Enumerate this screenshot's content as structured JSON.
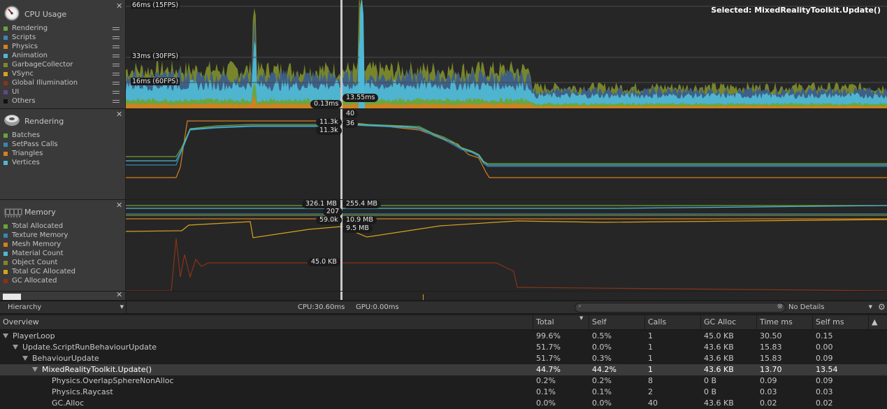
{
  "colors": {
    "rendering": "#6aa53a",
    "scripts": "#3a86b4",
    "physics": "#d4801e",
    "animation": "#4fb8d4",
    "garbage": "#7c8a2a",
    "vsync": "#d9a21e",
    "gi": "#8a3318",
    "ui": "#5d4a8c",
    "others": "#000000",
    "grid": "#4a4a4a",
    "cursor": "#c8c8c8"
  },
  "cpu": {
    "title": "CPU Usage",
    "icon": "cpu-meter-icon",
    "legend": [
      {
        "label": "Rendering",
        "color": "#6aa53a"
      },
      {
        "label": "Scripts",
        "color": "#3a86b4"
      },
      {
        "label": "Physics",
        "color": "#d4801e"
      },
      {
        "label": "Animation",
        "color": "#4fb8d4"
      },
      {
        "label": "GarbageCollector",
        "color": "#7c8a2a"
      },
      {
        "label": "VSync",
        "color": "#d9a21e"
      },
      {
        "label": "Global Illumination",
        "color": "#8a3318"
      },
      {
        "label": "UI",
        "color": "#5d4a8c"
      },
      {
        "label": "Others",
        "color": "#111111"
      }
    ],
    "ref_66": "66ms (15FPS)",
    "ref_33": "33ms (30FPS)",
    "ref_16": "16ms (60FPS)",
    "selected_label": "Selected: MixedRealityToolkit.Update()",
    "tag_left": "0.13ms",
    "tag_right": "13.55ms"
  },
  "rendering": {
    "title": "Rendering",
    "icon": "rendering-sphere-icon",
    "legend": [
      {
        "label": "Batches",
        "color": "#6aa53a"
      },
      {
        "label": "SetPass Calls",
        "color": "#3a86b4"
      },
      {
        "label": "Triangles",
        "color": "#d4801e"
      },
      {
        "label": "Vertices",
        "color": "#4fb8d4"
      }
    ],
    "tag_a": "40",
    "tag_b": "11.3k",
    "tag_c": "36",
    "tag_d": "11.3k"
  },
  "memory": {
    "title": "Memory",
    "icon": "memory-chip-icon",
    "legend": [
      {
        "label": "Total Allocated",
        "color": "#6aa53a"
      },
      {
        "label": "Texture Memory",
        "color": "#3a86b4"
      },
      {
        "label": "Mesh Memory",
        "color": "#d4801e"
      },
      {
        "label": "Material Count",
        "color": "#4fb8d4"
      },
      {
        "label": "Object Count",
        "color": "#7c8a2a"
      },
      {
        "label": "Total GC Allocated",
        "color": "#d9a21e"
      },
      {
        "label": "GC Allocated",
        "color": "#8a3318"
      }
    ],
    "tag_total": "326.1 MB",
    "tag_texture": "255.4 MB",
    "tag_materials": "207",
    "tag_objects": "59.0k",
    "tag_mesh": "10.9 MB",
    "tag_gc_total": "9.5 MB",
    "tag_gc": "45.0 KB"
  },
  "toolbar": {
    "view_mode": "Hierarchy",
    "cpu_time": "CPU:30.60ms",
    "gpu_time": "GPU:0.00ms",
    "search_placeholder": "",
    "details_mode": "No Details"
  },
  "table": {
    "columns": [
      "Overview",
      "Total",
      "Self",
      "Calls",
      "GC Alloc",
      "Time ms",
      "Self ms"
    ],
    "rows": [
      {
        "name": "PlayerLoop",
        "indent": 0,
        "expanded": true,
        "total": "99.6%",
        "self": "0.5%",
        "calls": "1",
        "gc": "45.0 KB",
        "time": "30.50",
        "selfms": "0.15",
        "selected": false
      },
      {
        "name": "Update.ScriptRunBehaviourUpdate",
        "indent": 1,
        "expanded": true,
        "total": "51.7%",
        "self": "0.0%",
        "calls": "1",
        "gc": "43.6 KB",
        "time": "15.83",
        "selfms": "0.00",
        "selected": false
      },
      {
        "name": "BehaviourUpdate",
        "indent": 2,
        "expanded": true,
        "total": "51.7%",
        "self": "0.3%",
        "calls": "1",
        "gc": "43.6 KB",
        "time": "15.83",
        "selfms": "0.09",
        "selected": false
      },
      {
        "name": "MixedRealityToolkit.Update()",
        "indent": 3,
        "expanded": true,
        "total": "44.7%",
        "self": "44.2%",
        "calls": "1",
        "gc": "43.6 KB",
        "time": "13.70",
        "selfms": "13.54",
        "selected": true
      },
      {
        "name": "Physics.OverlapSphereNonAlloc",
        "indent": 4,
        "expanded": false,
        "total": "0.2%",
        "self": "0.2%",
        "calls": "8",
        "gc": "0 B",
        "time": "0.09",
        "selfms": "0.09",
        "selected": false
      },
      {
        "name": "Physics.Raycast",
        "indent": 4,
        "expanded": false,
        "total": "0.1%",
        "self": "0.1%",
        "calls": "2",
        "gc": "0 B",
        "time": "0.03",
        "selfms": "0.03",
        "selected": false
      },
      {
        "name": "GC.Alloc",
        "indent": 4,
        "expanded": false,
        "total": "0.0%",
        "self": "0.0%",
        "calls": "40",
        "gc": "43.6 KB",
        "time": "0.02",
        "selfms": "0.02",
        "selected": false
      }
    ]
  }
}
